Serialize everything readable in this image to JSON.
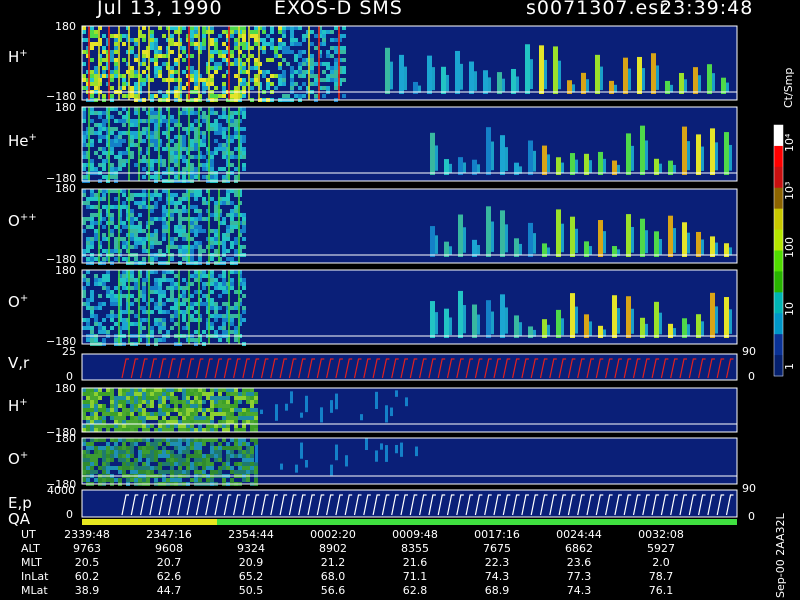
{
  "header": {
    "date": "Jul 13, 1990",
    "mission": "EXOS-D SMS",
    "filename": "s0071307.esr",
    "time": "23:39:48"
  },
  "panels": [
    {
      "ion": "H",
      "charge": "+",
      "ymax": "180",
      "ymin": "−180"
    },
    {
      "ion": "He",
      "charge": "+",
      "ymax": "180",
      "ymin": "−180"
    },
    {
      "ion": "O",
      "charge": "++",
      "ymax": "180",
      "ymin": "−180"
    },
    {
      "ion": "O",
      "charge": "+",
      "ymax": "180",
      "ymin": "−180"
    },
    {
      "ion": "V,r",
      "charge": "",
      "ymax": "25",
      "ymin": "0",
      "right": "90",
      "right_low": "0"
    },
    {
      "ion": "H",
      "charge": "+",
      "ymax": "180",
      "ymin": "−180"
    },
    {
      "ion": "O",
      "charge": "+",
      "ymax": "180",
      "ymin": "−180"
    },
    {
      "ion": "E,p",
      "charge": "",
      "ymax": "4000",
      "ymin": "0",
      "right": "90",
      "right_low": "0"
    }
  ],
  "qa_label": "QA",
  "colorbar": {
    "unit": "Ct/Smp",
    "ticks": [
      "10⁴",
      "10³",
      "100",
      "10",
      "1"
    ],
    "colors": [
      "#ffffff",
      "#ff0000",
      "#c81010",
      "#8c6400",
      "#c8c800",
      "#b4e600",
      "#50dc00",
      "#28b400",
      "#00b4b4",
      "#0096c8",
      "#0a3296",
      "#05206e"
    ]
  },
  "time_table": {
    "rows": [
      {
        "name": "UT",
        "values": [
          "2339:48",
          "2347:16",
          "2354:44",
          "0002:20",
          "0009:48",
          "0017:16",
          "0024:44",
          "0032:08"
        ]
      },
      {
        "name": "ALT",
        "values": [
          "9763",
          "9608",
          "9324",
          "8902",
          "8355",
          "7675",
          "6862",
          "5927"
        ]
      },
      {
        "name": "MLT",
        "values": [
          "20.5",
          "20.7",
          "20.9",
          "21.2",
          "21.6",
          "22.3",
          "23.6",
          "2.0"
        ]
      },
      {
        "name": "InLat",
        "values": [
          "60.2",
          "62.6",
          "65.2",
          "68.0",
          "71.1",
          "74.3",
          "77.3",
          "78.7"
        ]
      },
      {
        "name": "MLat",
        "values": [
          "38.9",
          "44.7",
          "50.5",
          "56.6",
          "62.8",
          "68.9",
          "74.3",
          "76.1"
        ]
      }
    ]
  },
  "stamp": "Sep-00 2AA32L",
  "chart_data": {
    "type": "heatmap",
    "title": "Jul 13, 1990   EXOS-D SMS   s0071307.esr   23:39:48",
    "x_ticks": [
      "2339:48",
      "2347:16",
      "2354:44",
      "0002:20",
      "0009:48",
      "0017:16",
      "0024:44",
      "0032:08"
    ],
    "colorbar_unit": "Ct/Smp",
    "colorbar_range": [
      1,
      10000
    ],
    "colorbar_scale": "log",
    "panels": [
      {
        "name": "H+",
        "ylim": [
          -180,
          180
        ]
      },
      {
        "name": "He+",
        "ylim": [
          -180,
          180
        ]
      },
      {
        "name": "O++",
        "ylim": [
          -180,
          180
        ]
      },
      {
        "name": "O+",
        "ylim": [
          -180,
          180
        ]
      },
      {
        "name": "V,r",
        "ylim": [
          0,
          25
        ],
        "y2lim": [
          0,
          90
        ]
      },
      {
        "name": "H+",
        "ylim": [
          -180,
          180
        ]
      },
      {
        "name": "O+",
        "ylim": [
          -180,
          180
        ]
      },
      {
        "name": "E,p",
        "ylim": [
          0,
          4000
        ],
        "y2lim": [
          0,
          90
        ]
      }
    ]
  }
}
